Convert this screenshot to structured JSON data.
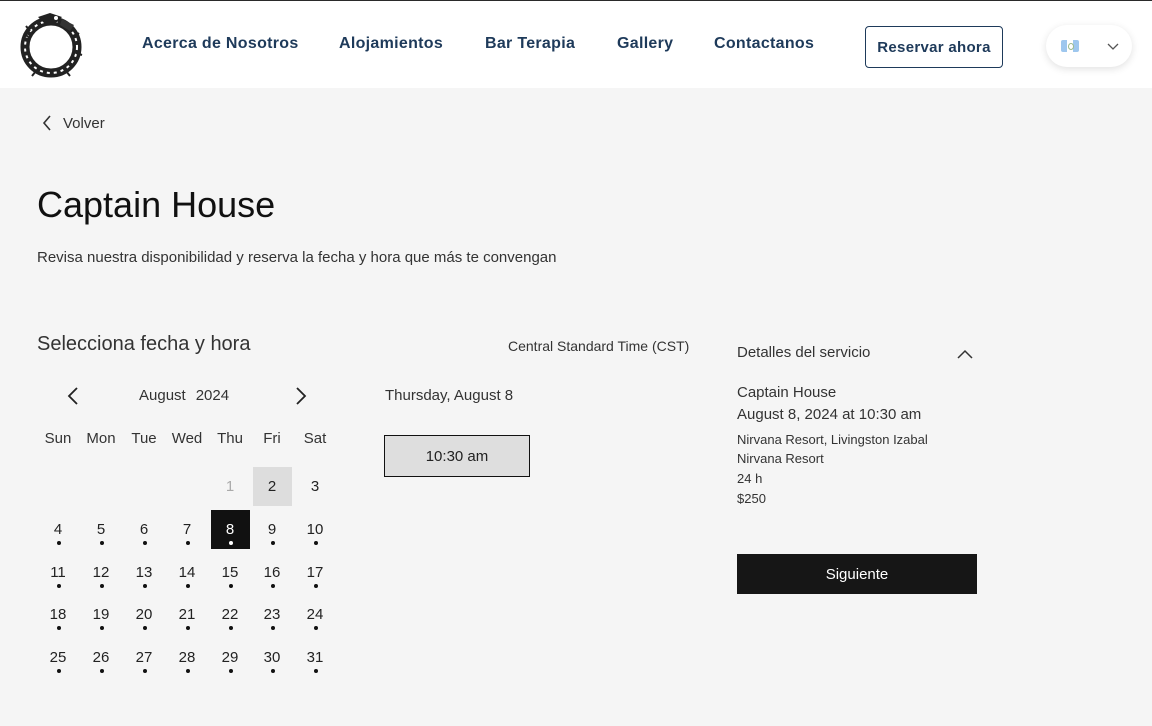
{
  "header": {
    "logo_icon": "serpent-ouroboros-logo-icon",
    "nav": [
      {
        "label": "Acerca de Nosotros"
      },
      {
        "label": "Alojamientos"
      },
      {
        "label": "Bar Terapia"
      },
      {
        "label": "Gallery"
      },
      {
        "label": "Contactanos"
      }
    ],
    "cta_label": "Reservar ahora",
    "language": {
      "flag_icon": "guatemala-flag-icon",
      "chevron_icon": "chevron-down-icon"
    },
    "colors": {
      "nav_text": "#1e3a5a",
      "background": "#ffffff"
    }
  },
  "back": {
    "label": "Volver",
    "icon": "chevron-left-icon"
  },
  "page": {
    "title": "Captain House",
    "subtitle": "Revisa nuestra disponibilidad y reserva la fecha y hora que más te convengan"
  },
  "booking": {
    "heading": "Selecciona fecha y hora",
    "timezone": "Central Standard Time (CST)",
    "calendar": {
      "month": "August",
      "year": "2024",
      "prev_icon": "chevron-left-icon",
      "next_icon": "chevron-right-icon",
      "weekdays": [
        "Sun",
        "Mon",
        "Tue",
        "Wed",
        "Thu",
        "Fri",
        "Sat"
      ],
      "weeks": [
        [
          null,
          null,
          null,
          null,
          "1",
          "2",
          "3"
        ],
        [
          "4",
          "5",
          "6",
          "7",
          "8",
          "9",
          "10"
        ],
        [
          "11",
          "12",
          "13",
          "14",
          "15",
          "16",
          "17"
        ],
        [
          "18",
          "19",
          "20",
          "21",
          "22",
          "23",
          "24"
        ],
        [
          "25",
          "26",
          "27",
          "28",
          "29",
          "30",
          "31"
        ]
      ],
      "disabled_days": [
        "1"
      ],
      "highlighted_day": "2",
      "selected_day": "8",
      "days_without_availability_dot": [
        "1",
        "2",
        "3"
      ]
    },
    "selected_date_label": "Thursday, August 8",
    "time_slots": [
      "10:30 am"
    ]
  },
  "service_details": {
    "heading": "Detalles del servicio",
    "toggle_icon": "chevron-up-icon",
    "name": "Captain House",
    "datetime": "August 8, 2024 at 10:30 am",
    "location": "Nirvana Resort, Livingston Izabal",
    "venue": "Nirvana Resort",
    "duration": "24 h",
    "price": "$250",
    "next_label": "Siguiente"
  },
  "colors": {
    "page_bg": "#f5f5f5",
    "selected_day_bg": "#111111",
    "highlight_day_bg": "#dddddd",
    "slot_bg": "#dedede",
    "button_bg": "#161616"
  }
}
